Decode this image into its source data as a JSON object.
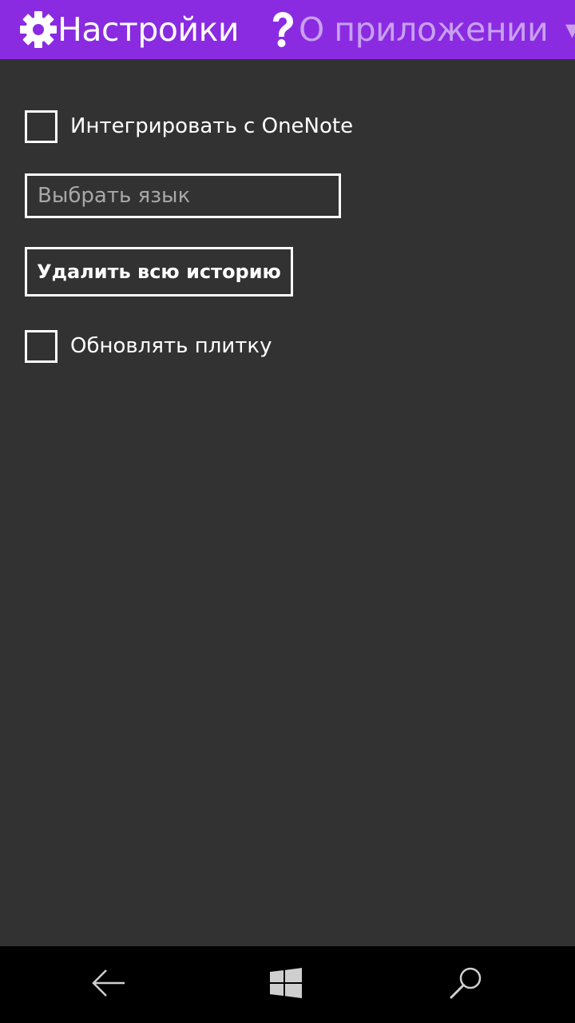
{
  "pivot": {
    "items": [
      {
        "label": "Настройки",
        "icon": "gear-icon",
        "active": true
      },
      {
        "label": "О приложении",
        "icon": "question-icon",
        "active": false
      }
    ],
    "overflow_glyph": "▾"
  },
  "settings": {
    "onenote_label": "Интегрировать с OneNote",
    "onenote_checked": false,
    "language_placeholder": "Выбрать язык",
    "language_value": "",
    "clear_history_label": "Удалить всю историю",
    "tile_label": "Обновлять плитку",
    "tile_checked": false
  },
  "navbar": {
    "back": "back-arrow-icon",
    "start": "windows-logo-icon",
    "search": "search-icon"
  },
  "colors": {
    "accent": "#8a2be2",
    "background": "#323232",
    "navbar": "#000000"
  }
}
